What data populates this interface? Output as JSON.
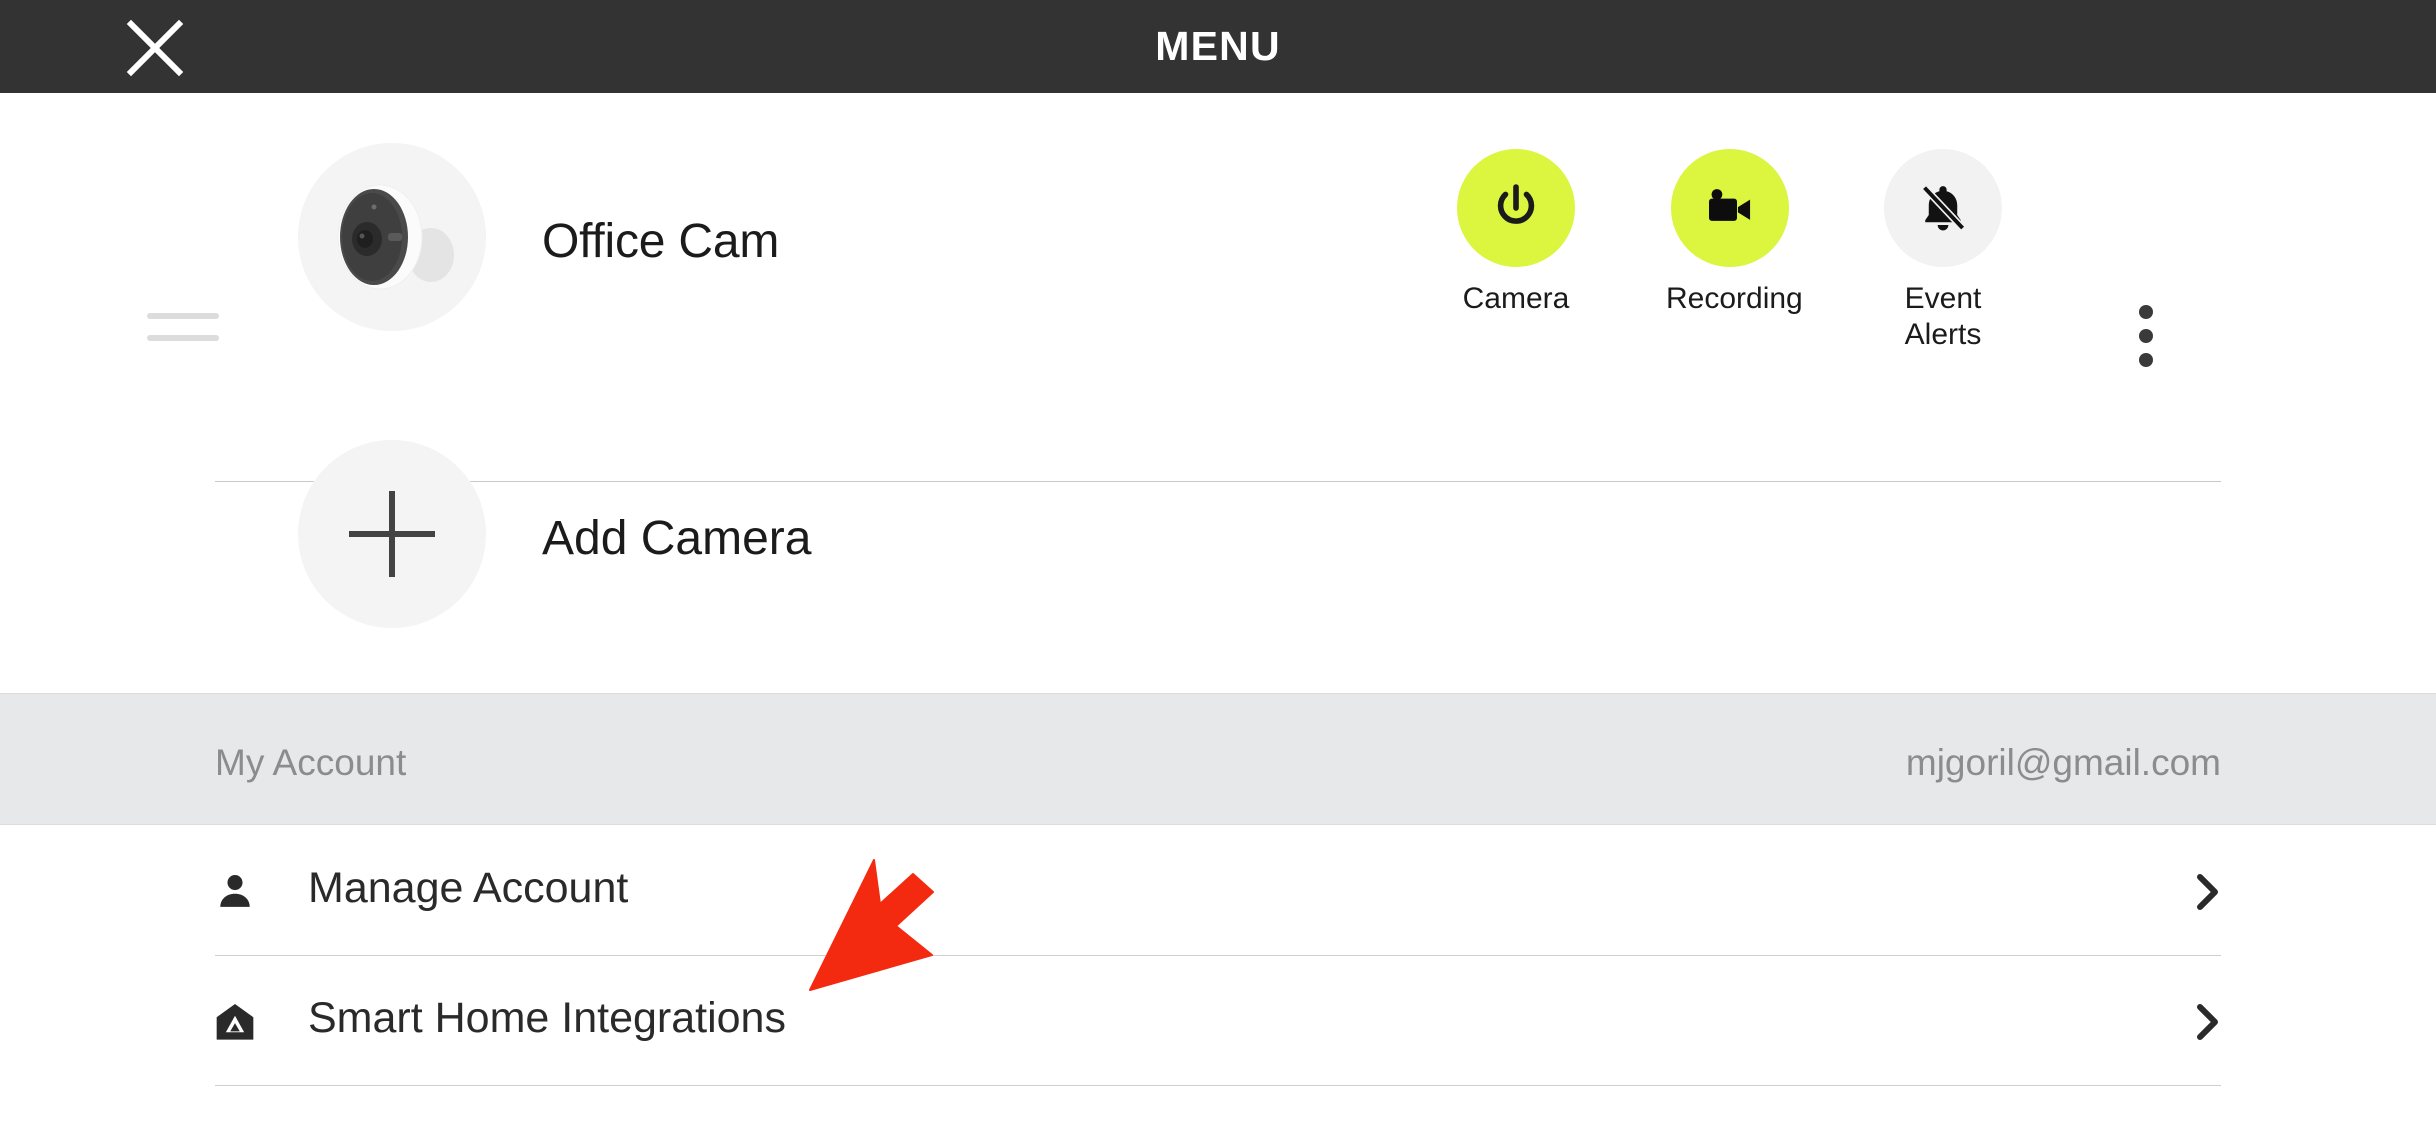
{
  "header": {
    "title": "MENU",
    "close_icon": "close-x-icon"
  },
  "camera": {
    "name": "Office Cam",
    "thumbnail_icon": "security-camera-thumbnail",
    "drag_handle_icon": "drag-handle-icon",
    "overflow_icon": "kebab-menu-icon",
    "actions": [
      {
        "label": "Camera",
        "icon": "power-icon",
        "state": "on",
        "color": "#dcf53f"
      },
      {
        "label": "Recording",
        "icon": "videocam-icon",
        "state": "on",
        "color": "#dcf53f"
      },
      {
        "label": "Event\nAlerts",
        "icon": "bell-off-icon",
        "state": "off",
        "color": "#f2f2f2"
      }
    ]
  },
  "add_camera": {
    "label": "Add Camera",
    "icon": "plus-icon"
  },
  "account": {
    "section_label": "My Account",
    "email": "mjgoril@gmail.com"
  },
  "menu_items": [
    {
      "label": "Manage Account",
      "icon": "person-icon",
      "chevron": "chevron-right-icon"
    },
    {
      "label": "Smart Home Integrations",
      "icon": "home-arlo-icon",
      "chevron": "chevron-right-icon"
    }
  ],
  "annotation": {
    "cursor_icon": "red-arrow-cursor",
    "color": "#f42a10"
  },
  "theme": {
    "topbar_bg": "#333333",
    "accent": "#dcf53f",
    "band_bg": "#e7e8ea",
    "text": "#1b1b1b"
  }
}
